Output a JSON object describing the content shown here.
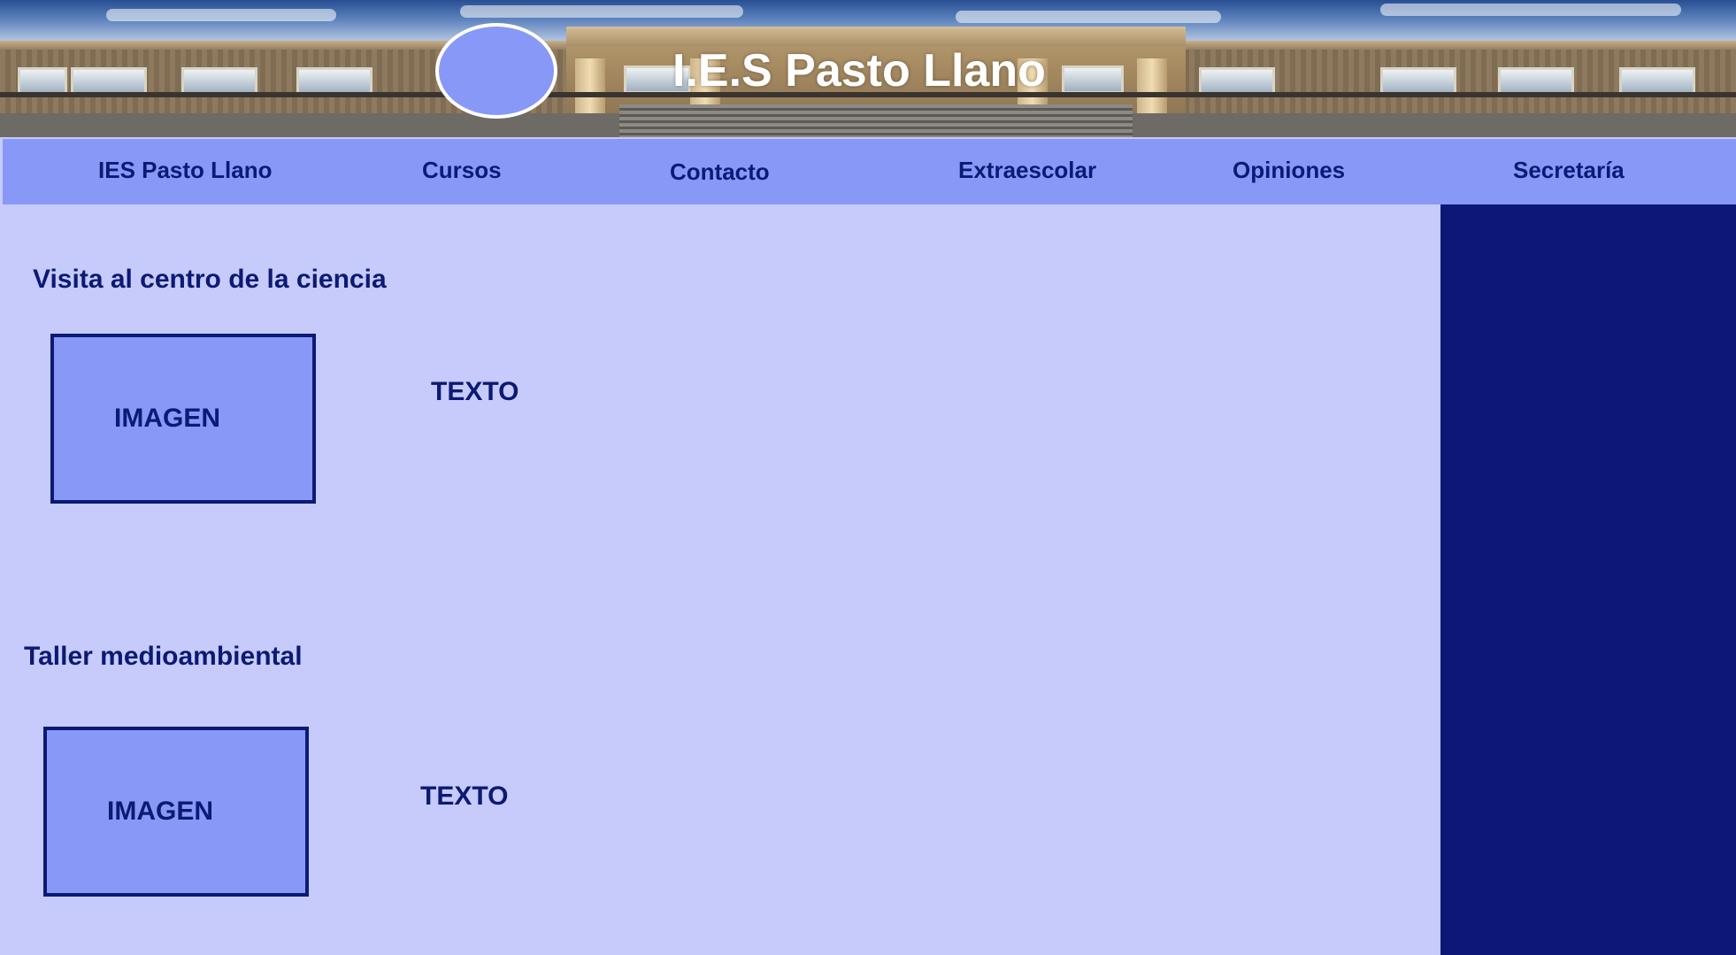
{
  "header": {
    "site_title": "I.E.S Pasto Llano"
  },
  "nav": {
    "items": [
      {
        "label": "IES Pasto Llano"
      },
      {
        "label": "Cursos"
      },
      {
        "label": "Contacto"
      },
      {
        "label": "Extraescolar"
      },
      {
        "label": "Opiniones"
      },
      {
        "label": "Secretaría"
      }
    ]
  },
  "main": {
    "sections": [
      {
        "title": "Visita al centro de la ciencia",
        "image_label": "IMAGEN",
        "text": "TEXTO"
      },
      {
        "title": "Taller medioambiental",
        "image_label": "IMAGEN",
        "text": "TEXTO"
      }
    ]
  },
  "colors": {
    "page_background": "#c6cbfb",
    "nav_background": "#8898f6",
    "text_navy": "#0c1a74",
    "sidebar": "#0c1876"
  }
}
